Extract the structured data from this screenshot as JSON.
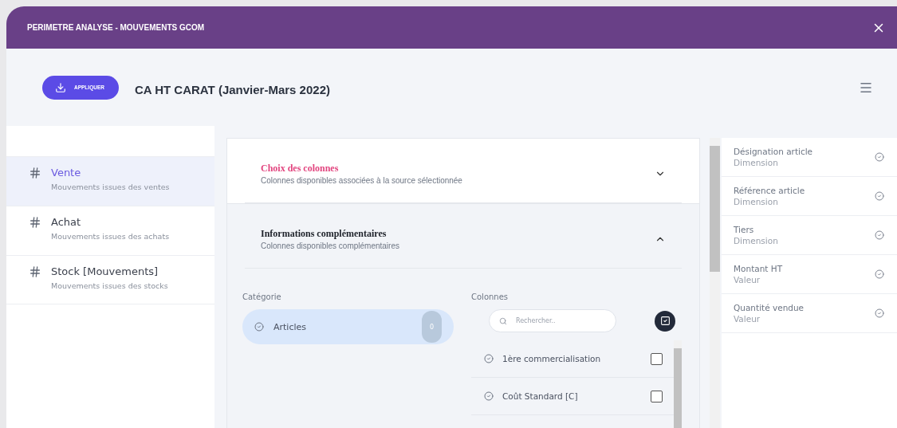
{
  "window": {
    "title": "PERIMETRE ANALYSE - MOUVEMENTS GCOM"
  },
  "toolbar": {
    "apply_button": "APPLIQUER",
    "report_title": "CA HT CARAT (Janvier-Mars 2022)"
  },
  "sources": [
    {
      "name": "Vente",
      "description": "Mouvements issues des ventes",
      "selected": true
    },
    {
      "name": "Achat",
      "description": "Mouvements issues des achats",
      "selected": false
    },
    {
      "name": "Stock [Mouvements]",
      "description": "Mouvements issues des stocks",
      "selected": false
    }
  ],
  "sections": [
    {
      "title": "Choix des colonnes",
      "subtitle": "Colonnes disponibles associées à la source sélectionnée",
      "expanded": false
    },
    {
      "title": "Informations complémentaires",
      "subtitle": "Colonnes disponibles complémentaires",
      "expanded": true
    }
  ],
  "categories_label": "Catégorie",
  "categories": [
    {
      "name": "Articles",
      "count": "0",
      "selected": true
    }
  ],
  "columns_label": "Colonnes",
  "search": {
    "placeholder": "Rechercher.."
  },
  "columns": [
    {
      "name": "1ère commercialisation",
      "checked": false
    },
    {
      "name": "Coût Standard [C]",
      "checked": false
    }
  ],
  "selected_columns": [
    {
      "name": "Désignation article",
      "type": "Dimension"
    },
    {
      "name": "Référence article",
      "type": "Dimension"
    },
    {
      "name": "Tiers",
      "type": "Dimension"
    },
    {
      "name": "Montant HT",
      "type": "Valeur"
    },
    {
      "name": "Quantité vendue",
      "type": "Valeur"
    }
  ]
}
